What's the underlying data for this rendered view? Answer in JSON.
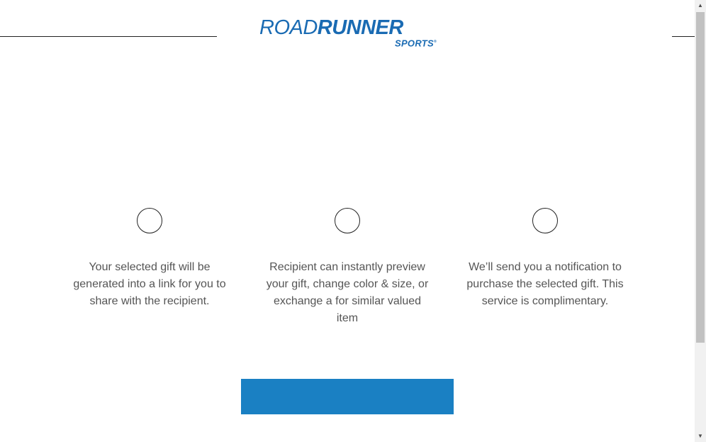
{
  "brand": {
    "logo_main_road": "ROAD",
    "logo_main_runner": "RUNNER",
    "logo_sub": "SPORTS",
    "logo_mark": "®",
    "color": "#1a6bb3"
  },
  "steps": [
    {
      "icon": "circle-icon",
      "text": "Your selected gift will be generated into a link for you to share with the recipient."
    },
    {
      "icon": "circle-icon",
      "text": "Recipient can instantly preview your gift, change color & size, or exchange a for similar valued item"
    },
    {
      "icon": "circle-icon",
      "text": "We’ll send you a notification to purchase the selected gift. This service is complimentary."
    }
  ],
  "cta": {
    "label": "",
    "color": "#1a80c3"
  },
  "scrollbar": {
    "up_arrow": "▲",
    "down_arrow": "▼"
  }
}
